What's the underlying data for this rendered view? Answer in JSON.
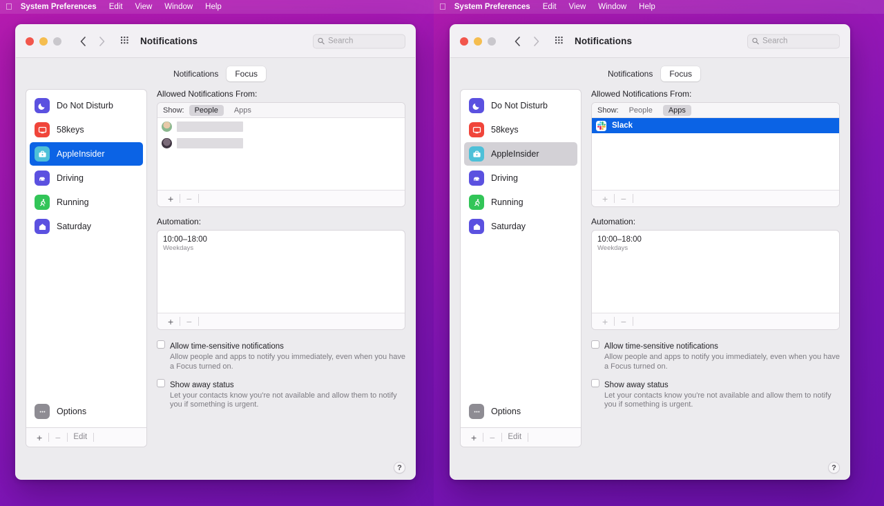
{
  "menubar": {
    "apple_icon": "apple-logo-icon",
    "app_name": "System Preferences",
    "items": [
      "Edit",
      "View",
      "Window",
      "Help"
    ]
  },
  "colors": {
    "accent_blue": "#0b63e5",
    "inactive_selection": "#d3d1d6",
    "window_bg": "#ecebee",
    "titlebar_bg": "#f2f0f4",
    "desktop_gradient_start": "#b81bb0",
    "desktop_gradient_end": "#6610a8"
  },
  "window": {
    "title": "Notifications",
    "search": {
      "placeholder": "Search",
      "value": ""
    },
    "nav": {
      "back_icon": "chevron-left-icon",
      "forward_icon": "chevron-right-icon",
      "grid_icon": "show-all-grid-icon"
    },
    "traffic": {
      "close": "close-button",
      "minimize": "minimize-button",
      "zoom": "zoom-button"
    },
    "tabs": [
      {
        "label": "Notifications",
        "selected": false
      },
      {
        "label": "Focus",
        "selected": true
      }
    ],
    "help_label": "?"
  },
  "sidebar": {
    "items": [
      {
        "label": "Do Not Disturb",
        "icon": "moon-icon",
        "icon_bg": "#5b51e0"
      },
      {
        "label": "58keys",
        "icon": "display-icon",
        "icon_bg": "#f0453a"
      },
      {
        "label": "AppleInsider",
        "icon": "briefcase-icon",
        "icon_bg": "#4ec0d8"
      },
      {
        "label": "Driving",
        "icon": "car-icon",
        "icon_bg": "#5b51e0"
      },
      {
        "label": "Running",
        "icon": "running-person-icon",
        "icon_bg": "#32c558"
      },
      {
        "label": "Saturday",
        "icon": "house-icon",
        "icon_bg": "#5b51e0"
      }
    ],
    "selected_index": 2,
    "options": {
      "label": "Options",
      "icon": "ellipsis-icon"
    },
    "footer": {
      "add": "+",
      "remove": "−",
      "edit": "Edit"
    }
  },
  "detail": {
    "allowed_label": "Allowed Notifications From:",
    "show_label": "Show:",
    "show_options": [
      {
        "label": "People"
      },
      {
        "label": "Apps"
      }
    ],
    "automation_label": "Automation:",
    "automation_rows": [
      {
        "time": "10:00–18:00",
        "repeat": "Weekdays"
      }
    ],
    "list_footer": {
      "add": "+",
      "remove": "−"
    },
    "checkboxes": [
      {
        "title": "Allow time-sensitive notifications",
        "desc": "Allow people and apps to notify you immediately, even when you have a Focus turned on.",
        "checked": false
      },
      {
        "title": "Show away status",
        "desc": "Let your contacts know you're not available and allow them to notify you if something is urgent.",
        "checked": false
      }
    ]
  },
  "left_window": {
    "show_selected": "People",
    "sidebar_selection_style": "active-blue",
    "people": [
      {
        "name": "",
        "redacted": true,
        "redact_width": 96,
        "avatar_color": "#8bb88f"
      },
      {
        "name": "",
        "redacted": true,
        "redact_width": 96,
        "avatar_color": "#564a55"
      }
    ],
    "apps": []
  },
  "right_window": {
    "show_selected": "Apps",
    "sidebar_selection_style": "inactive-grey",
    "people": [],
    "apps": [
      {
        "name": "Slack",
        "icon": "slack-icon",
        "selected": true
      }
    ]
  }
}
